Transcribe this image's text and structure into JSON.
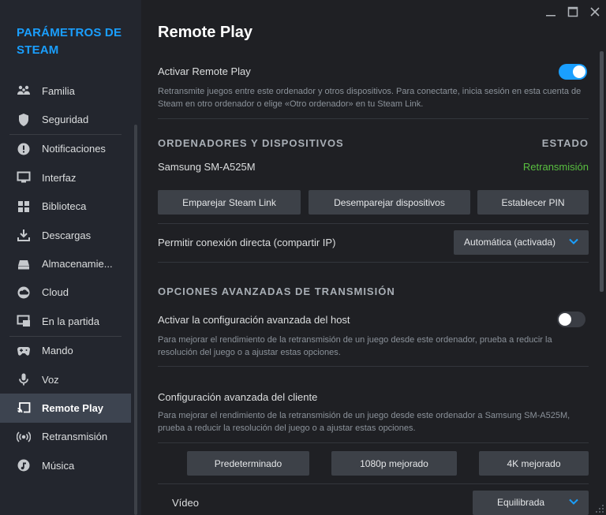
{
  "sidebar": {
    "brand": "PARÁMETROS DE STEAM",
    "items": [
      {
        "label": "Familia",
        "icon": "family-icon"
      },
      {
        "label": "Seguridad",
        "icon": "shield-icon"
      },
      {
        "label": "Notificaciones",
        "icon": "alert-icon"
      },
      {
        "label": "Interfaz",
        "icon": "monitor-icon"
      },
      {
        "label": "Biblioteca",
        "icon": "grid-icon"
      },
      {
        "label": "Descargas",
        "icon": "download-icon"
      },
      {
        "label": "Almacenamie...",
        "icon": "storage-icon"
      },
      {
        "label": "Cloud",
        "icon": "cloud-icon"
      },
      {
        "label": "En la partida",
        "icon": "ingame-icon"
      },
      {
        "label": "Mando",
        "icon": "controller-icon"
      },
      {
        "label": "Voz",
        "icon": "microphone-icon"
      },
      {
        "label": "Remote Play",
        "icon": "remote-play-icon",
        "active": true
      },
      {
        "label": "Retransmisión",
        "icon": "broadcast-icon"
      },
      {
        "label": "Música",
        "icon": "music-icon"
      }
    ]
  },
  "main": {
    "title": "Remote Play",
    "enable_label": "Activar Remote Play",
    "enable_on": true,
    "enable_desc": "Retransmite juegos entre este ordenador y otros dispositivos. Para conectarte, inicia sesión en esta cuenta de Steam en otro ordenador o elige «Otro ordenador» en tu Steam Link.",
    "devices_head": "ORDENADORES Y DISPOSITIVOS",
    "status_head": "ESTADO",
    "device_name": "Samsung SM-A525M",
    "device_status": "Retransmisión",
    "btn_pair": "Emparejar Steam Link",
    "btn_unpair": "Desemparejar dispositivos",
    "btn_pin": "Establecer PIN",
    "direct_label": "Permitir conexión directa (compartir IP)",
    "direct_value": "Automática (activada)",
    "advanced_head": "OPCIONES AVANZADAS DE TRANSMISIÓN",
    "host_label": "Activar la configuración avanzada del host",
    "host_on": false,
    "host_desc": "Para mejorar el rendimiento de la retransmisión de un juego desde este ordenador, prueba a reducir la resolución del juego o a ajustar estas opciones.",
    "client_label": "Configuración avanzada del cliente",
    "client_desc": "Para mejorar el rendimiento de la retransmisión de un juego desde este ordenador a Samsung SM-A525M, prueba a reducir la resolución del juego o a ajustar estas opciones.",
    "preset_default": "Predeterminado",
    "preset_1080": "1080p mejorado",
    "preset_4k": "4K mejorado",
    "video_label": "Vídeo",
    "video_value": "Equilibrada"
  },
  "colors": {
    "accent": "#1a9fff",
    "status_green": "#59bf40",
    "background": "#1f2024",
    "sidebar": "#23262e"
  }
}
